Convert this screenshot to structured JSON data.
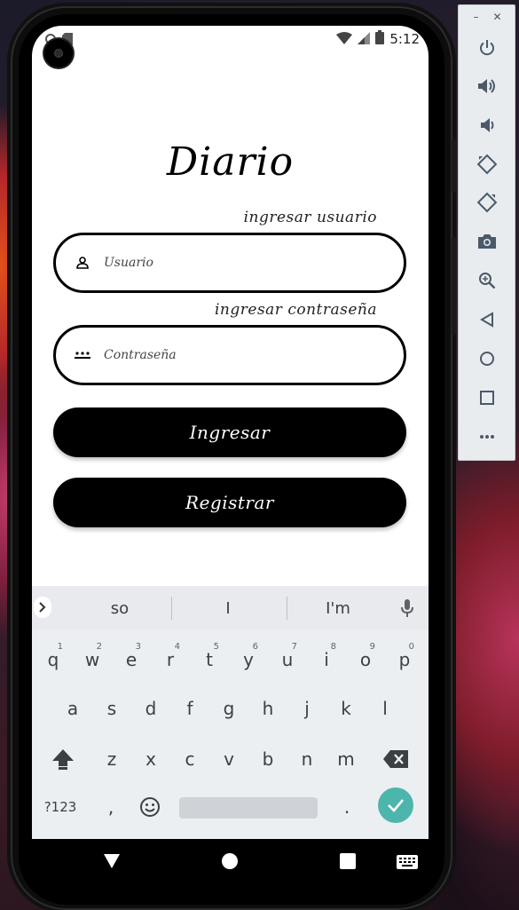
{
  "status_bar": {
    "time": "5:12"
  },
  "app": {
    "title": "Diario",
    "user_hint": "ingresar usuario",
    "user_placeholder": "Usuario",
    "password_hint": "ingresar contraseña",
    "password_placeholder": "Contraseña",
    "login_label": "Ingresar",
    "register_label": "Registrar"
  },
  "keyboard": {
    "suggestions": [
      "so",
      "I",
      "I'm"
    ],
    "row1": [
      {
        "key": "q",
        "num": "1"
      },
      {
        "key": "w",
        "num": "2"
      },
      {
        "key": "e",
        "num": "3"
      },
      {
        "key": "r",
        "num": "4"
      },
      {
        "key": "t",
        "num": "5"
      },
      {
        "key": "y",
        "num": "6"
      },
      {
        "key": "u",
        "num": "7"
      },
      {
        "key": "i",
        "num": "8"
      },
      {
        "key": "o",
        "num": "9"
      },
      {
        "key": "p",
        "num": "0"
      }
    ],
    "row2": [
      "a",
      "s",
      "d",
      "f",
      "g",
      "h",
      "j",
      "k",
      "l"
    ],
    "row3": [
      "z",
      "x",
      "c",
      "v",
      "b",
      "n",
      "m"
    ],
    "symbols_label": "?123",
    "comma_label": ",",
    "period_label": "."
  },
  "colors": {
    "accent": "#4db6ac",
    "keyboard_bg": "#eceff1",
    "button_bg": "#000000"
  },
  "emulator_toolbar": {
    "icons": [
      "power-icon",
      "volume-up-icon",
      "volume-down-icon",
      "rotate-left-icon",
      "rotate-right-icon",
      "camera-icon",
      "zoom-icon",
      "back-icon",
      "home-icon",
      "overview-icon",
      "more-icon"
    ]
  }
}
